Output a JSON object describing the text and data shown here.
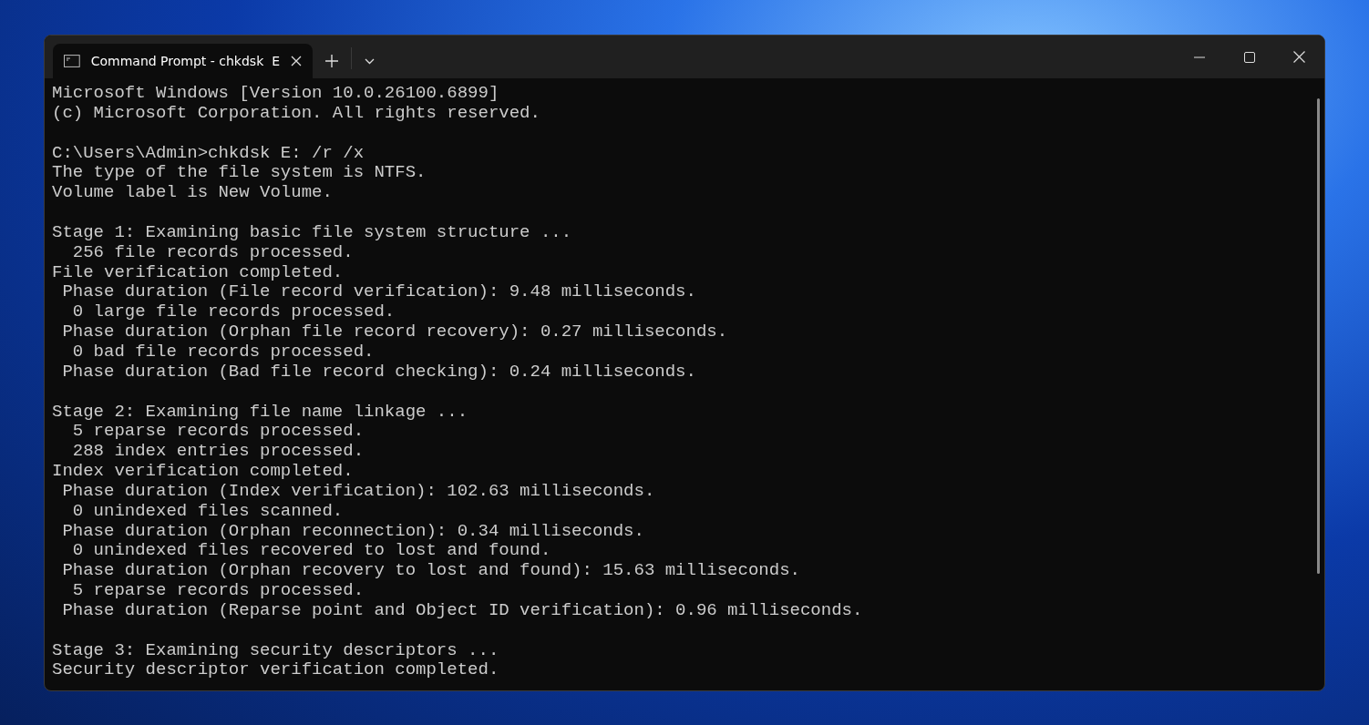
{
  "tab": {
    "title": "Command Prompt - chkdsk  E",
    "selected": true
  },
  "blocks": [
    [
      "Microsoft Windows [Version 10.0.26100.6899]",
      "(c) Microsoft Corporation. All rights reserved."
    ],
    [
      "C:\\Users\\Admin>chkdsk E: /r /x",
      "The type of the file system is NTFS.",
      "Volume label is New Volume."
    ],
    [
      "Stage 1: Examining basic file system structure ...",
      "  256 file records processed.",
      "File verification completed.",
      " Phase duration (File record verification): 9.48 milliseconds.",
      "  0 large file records processed.",
      " Phase duration (Orphan file record recovery): 0.27 milliseconds.",
      "  0 bad file records processed.",
      " Phase duration (Bad file record checking): 0.24 milliseconds."
    ],
    [
      "Stage 2: Examining file name linkage ...",
      "  5 reparse records processed.",
      "  288 index entries processed.",
      "Index verification completed.",
      " Phase duration (Index verification): 102.63 milliseconds.",
      "  0 unindexed files scanned.",
      " Phase duration (Orphan reconnection): 0.34 milliseconds.",
      "  0 unindexed files recovered to lost and found.",
      " Phase duration (Orphan recovery to lost and found): 15.63 milliseconds.",
      "  5 reparse records processed.",
      " Phase duration (Reparse point and Object ID verification): 0.96 milliseconds."
    ],
    [
      "Stage 3: Examining security descriptors ...",
      "Security descriptor verification completed."
    ]
  ]
}
